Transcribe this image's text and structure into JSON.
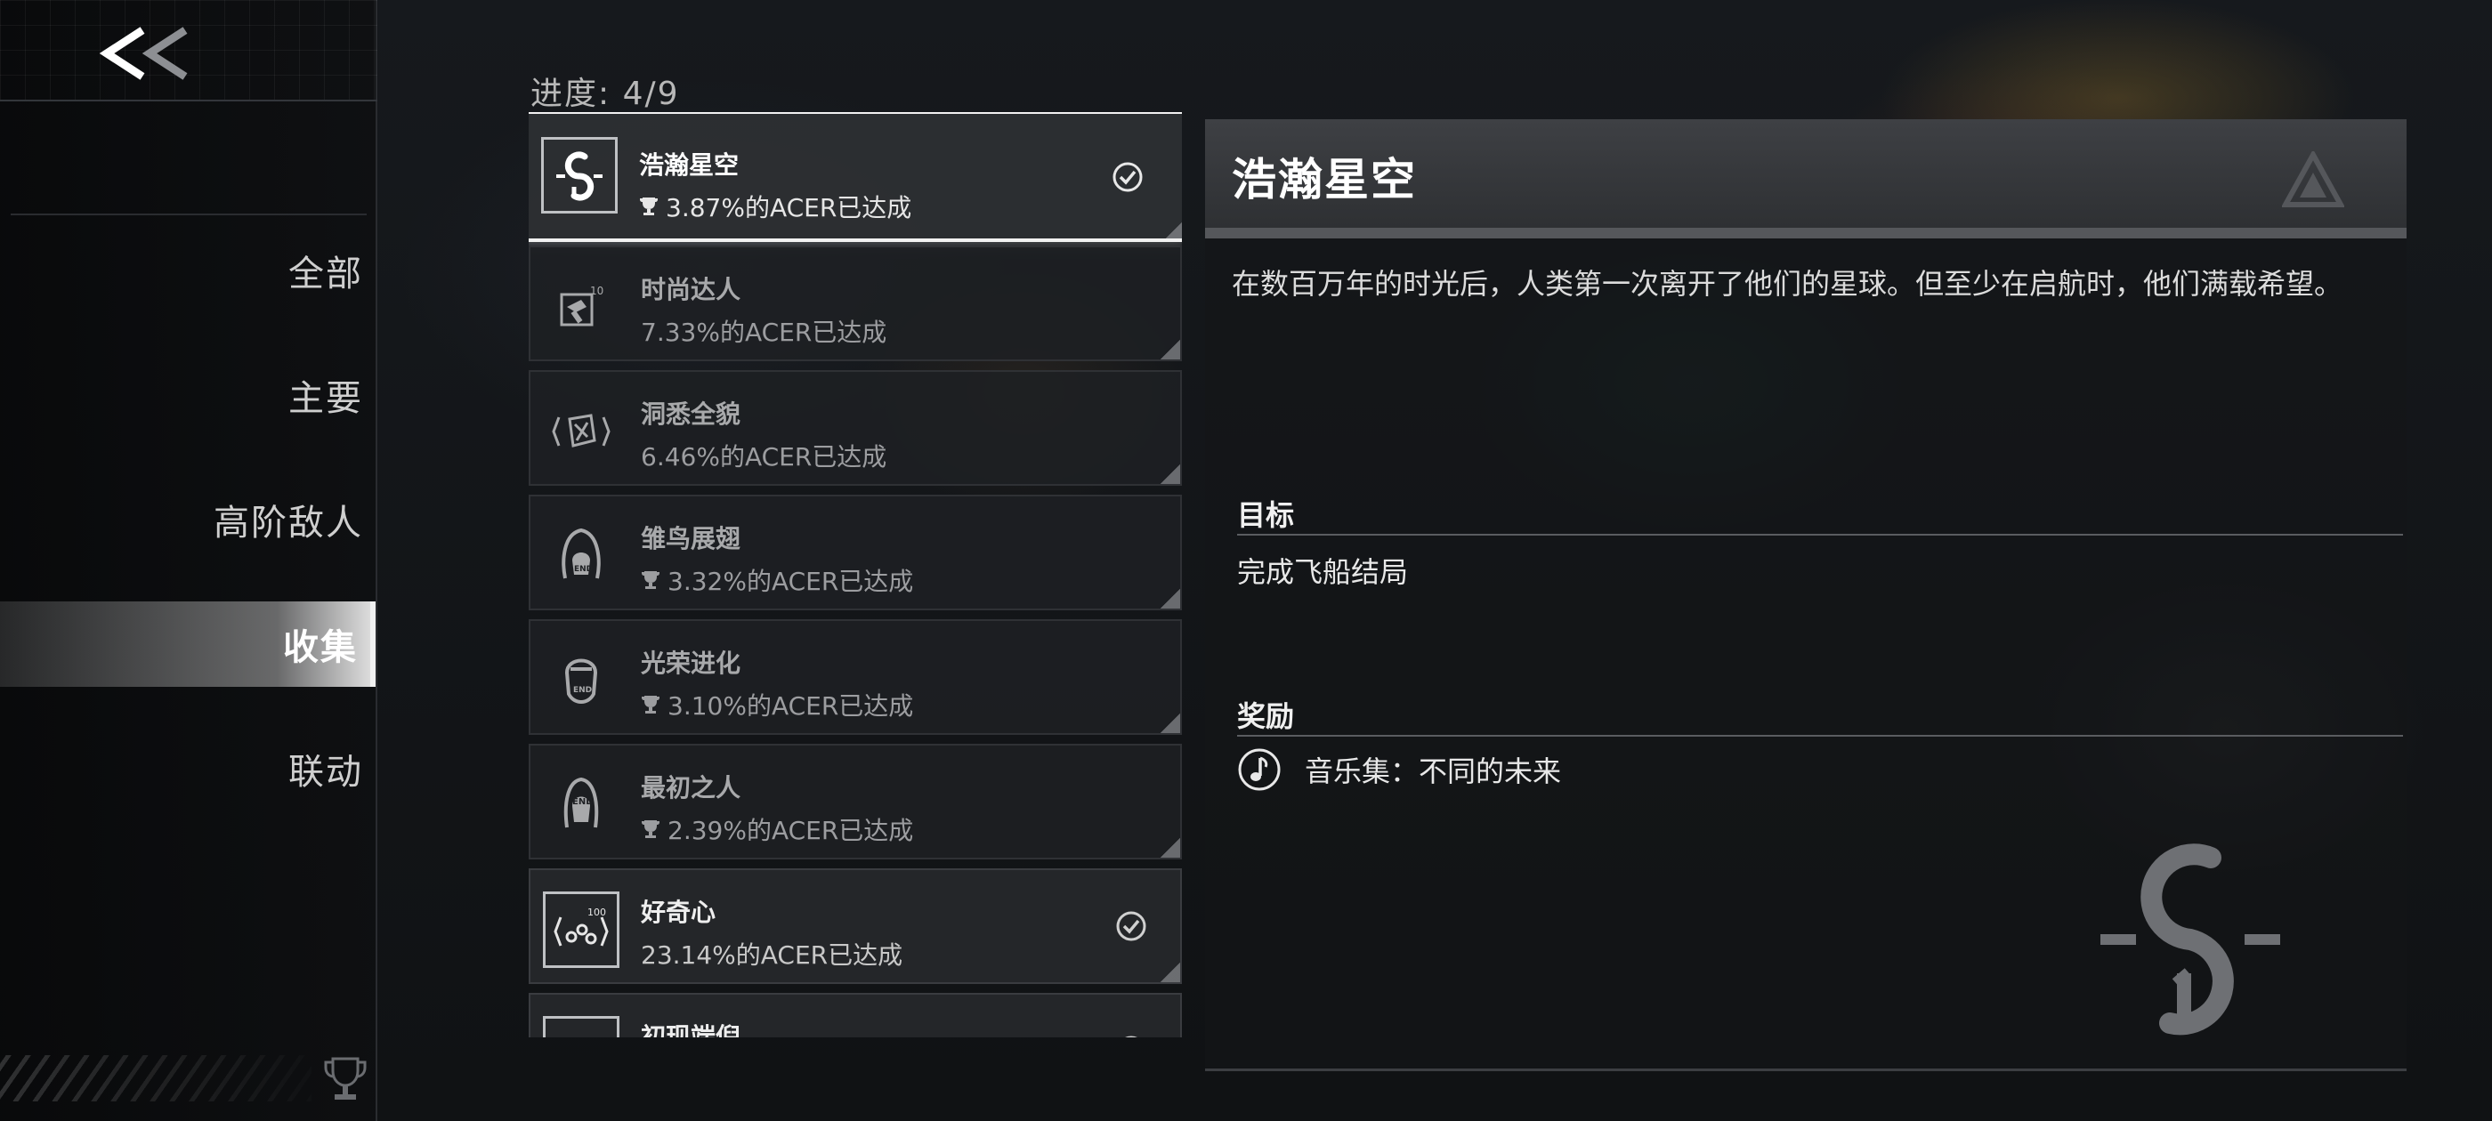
{
  "nav": {
    "back_label": "<<",
    "items": [
      {
        "label": "全部"
      },
      {
        "label": "主要"
      },
      {
        "label": "高阶敌人"
      },
      {
        "label": "收集",
        "active": true
      },
      {
        "label": "联动"
      }
    ]
  },
  "progress": {
    "label": "进度: 4/9"
  },
  "achievements": [
    {
      "title": "浩瀚星空",
      "stat": "3.87%的ACER已达成",
      "trophy": true,
      "completed": true,
      "selected": true,
      "icon": "spiral-logo-icon"
    },
    {
      "title": "时尚达人",
      "stat": "7.33%的ACER已达成",
      "trophy": false,
      "completed": false,
      "icon": "hammer-10-icon"
    },
    {
      "title": "洞悉全貌",
      "stat": "6.46%的ACER已达成",
      "trophy": false,
      "completed": false,
      "icon": "map-fragment-icon"
    },
    {
      "title": "雏鸟展翅",
      "stat": "3.32%的ACER已达成",
      "trophy": true,
      "completed": false,
      "icon": "end-head-icon"
    },
    {
      "title": "光荣进化",
      "stat": "3.10%的ACER已达成",
      "trophy": true,
      "completed": false,
      "icon": "end-head-icon"
    },
    {
      "title": "最初之人",
      "stat": "2.39%的ACER已达成",
      "trophy": true,
      "completed": false,
      "icon": "end-head-icon"
    },
    {
      "title": "好奇心",
      "stat": "23.14%的ACER已达成",
      "trophy": false,
      "completed": true,
      "icon": "dots-100-icon"
    },
    {
      "title": "初现端倪",
      "stat": "",
      "trophy": false,
      "completed": true,
      "icon": "partial-icon"
    }
  ],
  "detail": {
    "title": "浩瀚星空",
    "description": "在数百万年的时光后，人类第一次离开了他们的星球。但至少在启航时，他们满载希望。",
    "goal_label": "目标",
    "goal_value": "完成飞船结局",
    "reward_label": "奖励",
    "reward_value": "音乐集：不同的未来",
    "reward_icon": "music-note-icon"
  },
  "colors": {
    "accent": "#f2f2f2",
    "card": "#26282b",
    "text": "#e8e8e8"
  }
}
